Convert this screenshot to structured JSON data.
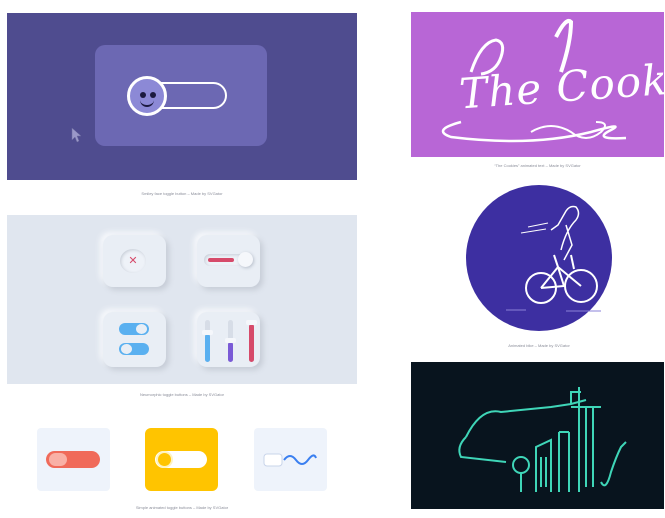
{
  "cards": [
    {
      "id": "smiley-toggle",
      "caption": "Smiley face toggle button – Made by SVGator",
      "colors": {
        "bg": "#4f4c8f",
        "card": "#6c68b3",
        "knob": "#8c89d6"
      }
    },
    {
      "id": "cookies",
      "caption": "“The Cookies” animated text – Made by SVGator",
      "art_text": "The Cookies",
      "colors": {
        "bg": "#b866d6",
        "text": "#ffffff"
      }
    },
    {
      "id": "neumorphic",
      "caption": "Neumorphic toggle buttons – Made by SVGator",
      "colors": {
        "bg": "#e0e6ef",
        "accent_red": "#d64a6a",
        "accent_blue": "#5ab0f0",
        "accent_purple": "#7a5ad6"
      }
    },
    {
      "id": "animated-rider",
      "caption": "Animated bike – Made by SVGator",
      "colors": {
        "circle": "#3d2fa1",
        "line": "#ffffff"
      }
    },
    {
      "id": "simple-toggles",
      "caption": "Simple animated toggle buttons – Made by SVGator",
      "colors": {
        "tile": "#eef3fb",
        "red": "#f06a5a",
        "yellow": "#ffc400",
        "blue": "#3a7ff0"
      }
    },
    {
      "id": "city-line",
      "caption": "",
      "colors": {
        "bg": "#08141e",
        "line": "#3fd6b8"
      }
    }
  ]
}
